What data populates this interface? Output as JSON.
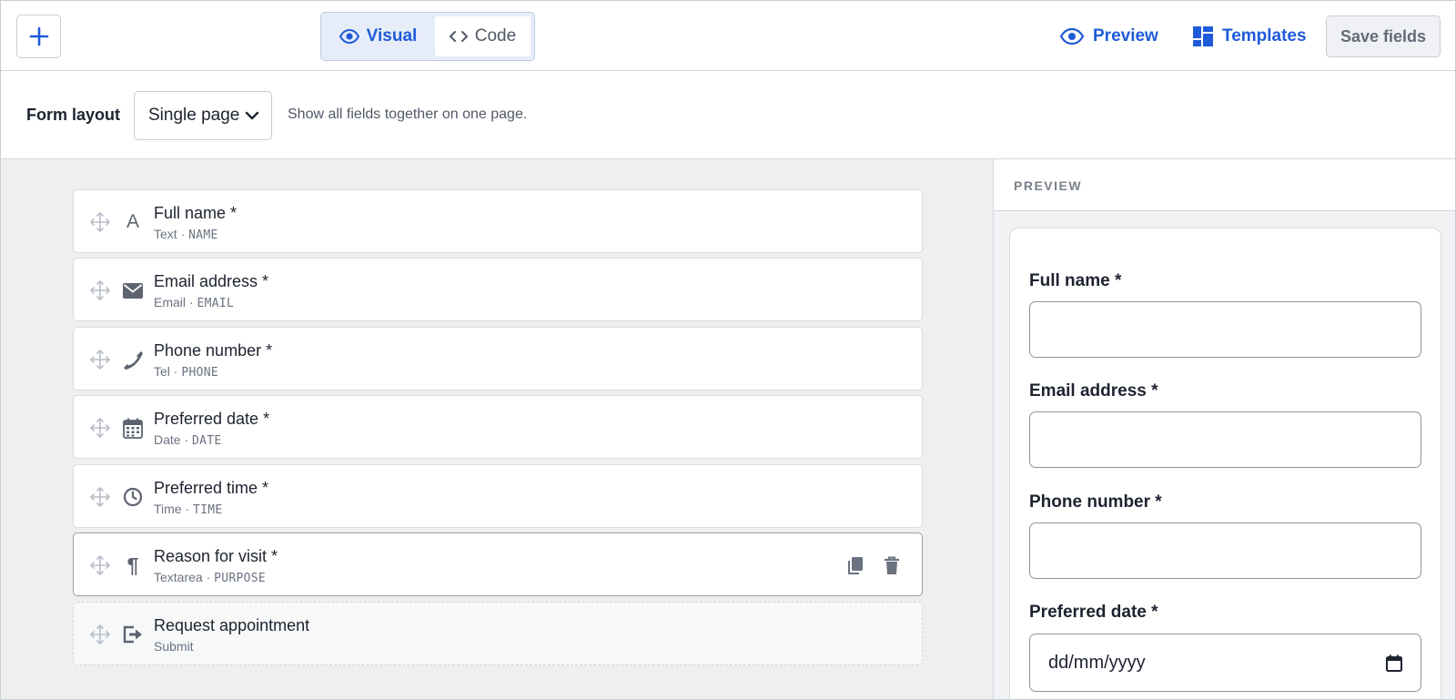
{
  "toolbar": {
    "add_icon": "plus-icon",
    "view_modes": [
      {
        "label": "Visual",
        "icon": "eye-icon",
        "active": true
      },
      {
        "label": "Code",
        "icon": "code-icon",
        "active": false
      }
    ],
    "preview_label": "Preview",
    "templates_label": "Templates",
    "save_label": "Save fields"
  },
  "layout": {
    "label": "Form layout",
    "selected": "Single page",
    "description": "Show all fields together on one page."
  },
  "fields": [
    {
      "title": "Full name *",
      "type": "Text",
      "key": "NAME",
      "icon": "text-icon"
    },
    {
      "title": "Email address *",
      "type": "Email",
      "key": "EMAIL",
      "icon": "envelope-icon"
    },
    {
      "title": "Phone number *",
      "type": "Tel",
      "key": "PHONE",
      "icon": "phone-icon"
    },
    {
      "title": "Preferred date *",
      "type": "Date",
      "key": "DATE",
      "icon": "calendar-icon"
    },
    {
      "title": "Preferred time *",
      "type": "Time",
      "key": "TIME",
      "icon": "clock-icon"
    },
    {
      "title": "Reason for visit *",
      "type": "Textarea",
      "key": "PURPOSE",
      "icon": "paragraph-icon",
      "selected": true
    }
  ],
  "submit": {
    "title": "Request appointment",
    "type": "Submit",
    "icon": "exit-icon"
  },
  "separator": "·",
  "preview": {
    "heading": "PREVIEW",
    "fields": [
      {
        "label": "Full name *"
      },
      {
        "label": "Email address *"
      },
      {
        "label": "Phone number *"
      },
      {
        "label": "Preferred date *",
        "placeholder": "dd/mm/yyyy"
      }
    ]
  },
  "colors": {
    "accent": "#1f5bd8",
    "canvas": "#efefef",
    "text": "#1e2330"
  }
}
